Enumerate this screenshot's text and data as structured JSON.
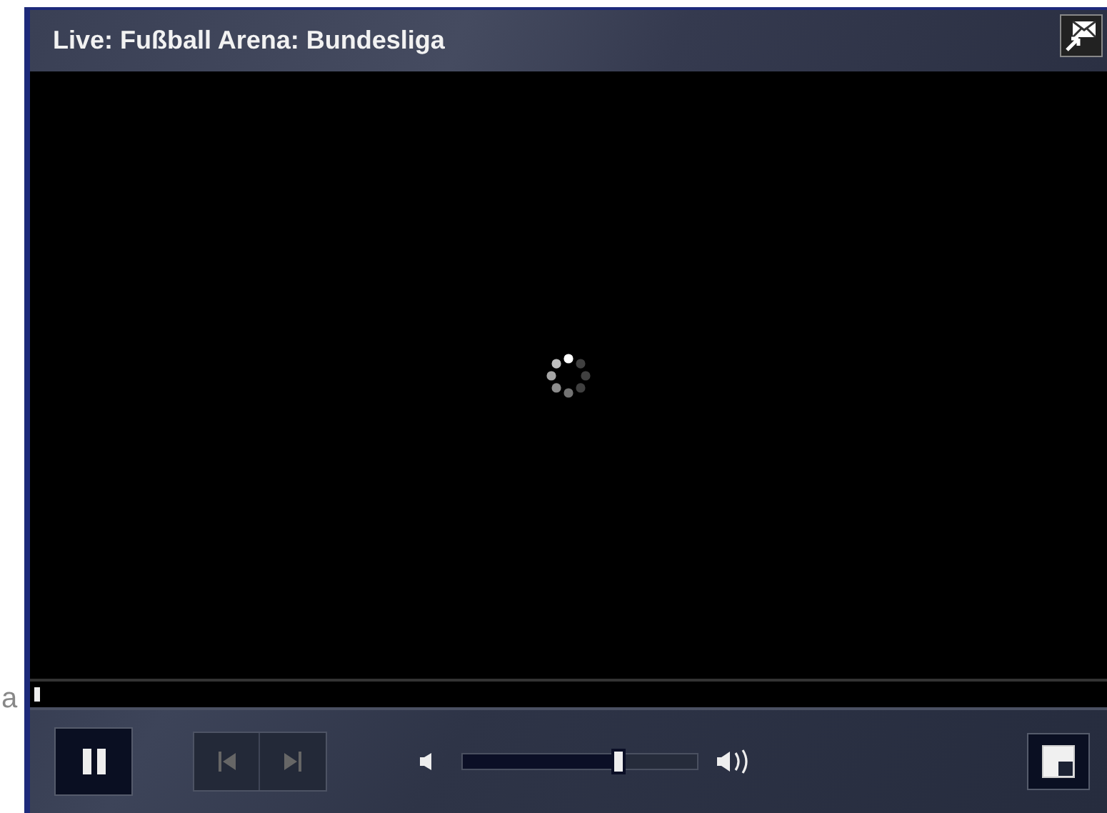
{
  "background_text": "a",
  "player": {
    "title": "Live: Fußball Arena: Bundesliga",
    "loading": true,
    "progress": {
      "level": 0
    },
    "playing": true,
    "volume": {
      "level": 0.67
    }
  }
}
